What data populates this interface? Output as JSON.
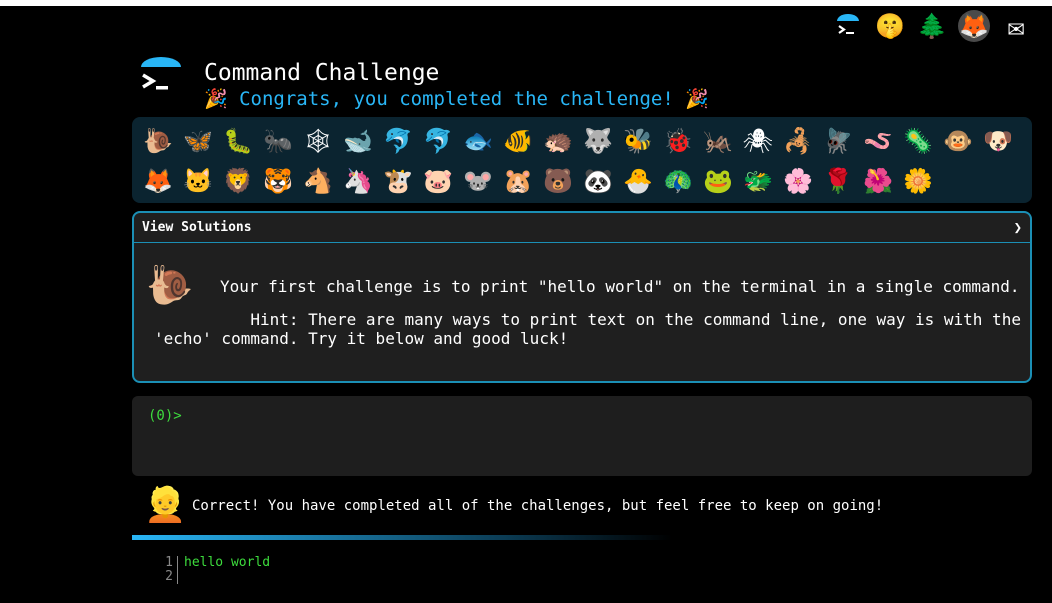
{
  "header": {
    "title": "Command Challenge",
    "subtitle": "🎉 Congrats, you completed the challenge! 🎉"
  },
  "topbar": {
    "icons": [
      {
        "name": "terminal-logo",
        "glyph": ">_"
      },
      {
        "name": "shushing-face",
        "glyph": "🤫"
      },
      {
        "name": "evergreen-tree",
        "glyph": "🌲"
      },
      {
        "name": "gitlab",
        "glyph": "🦊"
      },
      {
        "name": "envelope",
        "glyph": "✉"
      }
    ]
  },
  "challenges": [
    "🐌",
    "🦋",
    "🐛",
    "🐜",
    "🕸",
    "🐋",
    "🐬",
    "🐬",
    "🐟",
    "🐠",
    "🦔",
    "🐺",
    "🐝",
    "🐞",
    "🦗",
    "🕷",
    "🦂",
    "🪰",
    "🪱",
    "🦠",
    "🐵",
    "🐶",
    "🦊",
    "🐱",
    "🦁",
    "🐯",
    "🐴",
    "🦄",
    "🐮",
    "🐷",
    "🐭",
    "🐹",
    "🐻",
    "🐼",
    "🐣",
    "🦚",
    "🐸",
    "🐲",
    "🌸",
    "🌹",
    "🌺",
    "🌼"
  ],
  "panel": {
    "header": "View Solutions",
    "chevron": "❯",
    "challenge_icon": "🐌",
    "description": "Your first challenge is to print \"hello world\" on the terminal in a single command.",
    "hint": "          Hint: There are many ways to print text on the command line, one way is with the\n'echo' command. Try it below and good luck!"
  },
  "terminal": {
    "prompt": "(0)>"
  },
  "feedback": {
    "avatar": "👱",
    "message": "Correct! You have completed all of the challenges, but feel free to keep on going!"
  },
  "output": {
    "lines": [
      {
        "num": "1",
        "text": "hello world"
      },
      {
        "num": "2",
        "text": ""
      }
    ]
  },
  "colors": {
    "accent": "#29b6f6",
    "terminal_green": "#3ddc3d",
    "panel_border": "#1b8fb5"
  }
}
